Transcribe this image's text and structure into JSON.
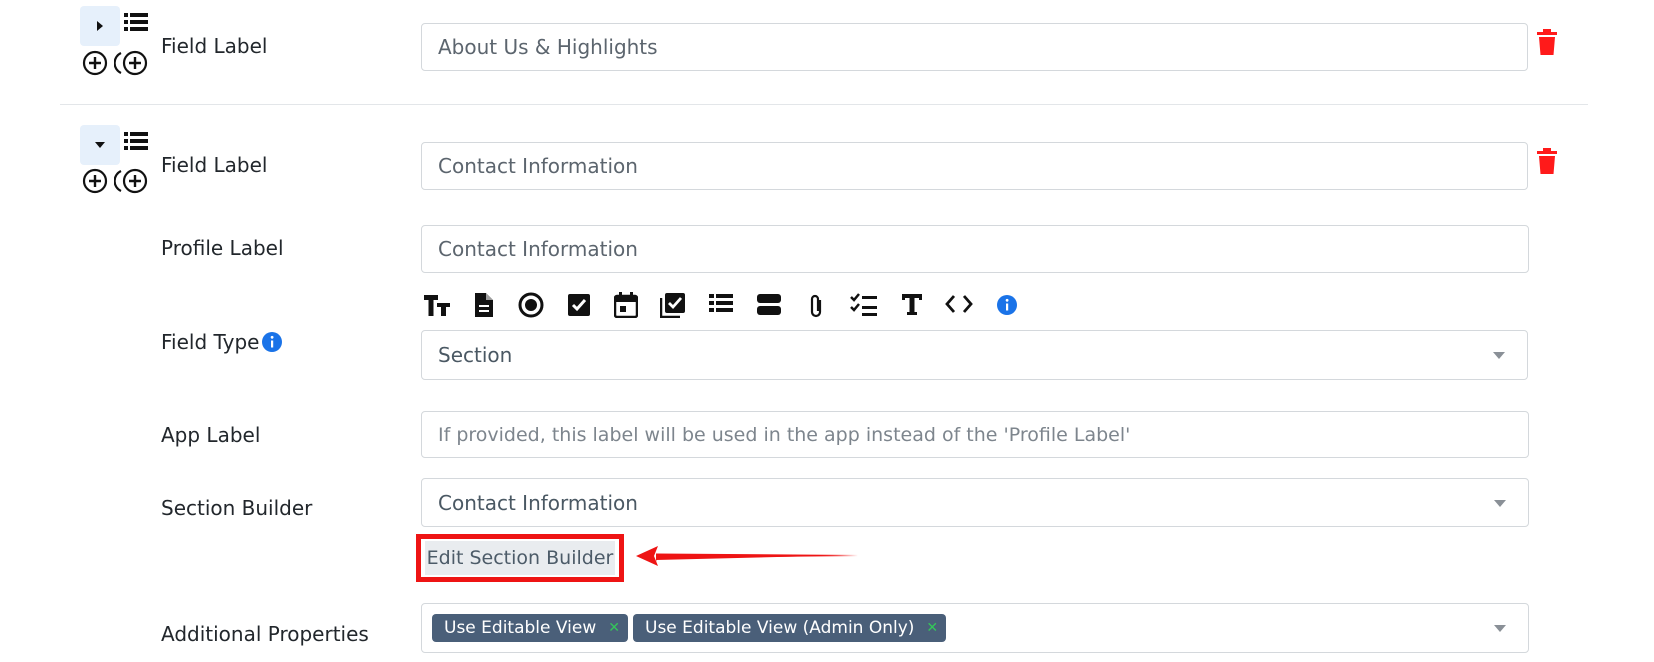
{
  "rows": [
    {
      "field_label": "Field Label",
      "field_value": "About Us & Highlights",
      "collapsed": true
    },
    {
      "field_label": "Field Label",
      "field_value": "Contact Information",
      "collapsed": false
    }
  ],
  "profile_label": {
    "label": "Profile Label",
    "value": "Contact Information"
  },
  "field_type": {
    "label": "Field Type",
    "selected": "Section",
    "toolbar_icons": [
      "text-size-icon",
      "document-icon",
      "radio-icon",
      "checkbox-icon",
      "calendar-icon",
      "multi-check-icon",
      "list-icon",
      "section-icon",
      "attachment-icon",
      "checklist-icon",
      "text-icon",
      "code-icon",
      "info-icon"
    ]
  },
  "app_label": {
    "label": "App Label",
    "placeholder": "If provided, this label will be used in the app instead of the 'Profile Label'"
  },
  "section_builder": {
    "label": "Section Builder",
    "selected": "Contact Information",
    "edit_button": "Edit Section Builder"
  },
  "additional_properties": {
    "label": "Additional Properties",
    "tags": [
      "Use Editable View",
      "Use Editable View (Admin Only)"
    ]
  },
  "colors": {
    "accent": "#1a73e8",
    "trash": "#ff1a1a",
    "tag_bg": "#4a5f79",
    "highlight": "#ee1414"
  }
}
